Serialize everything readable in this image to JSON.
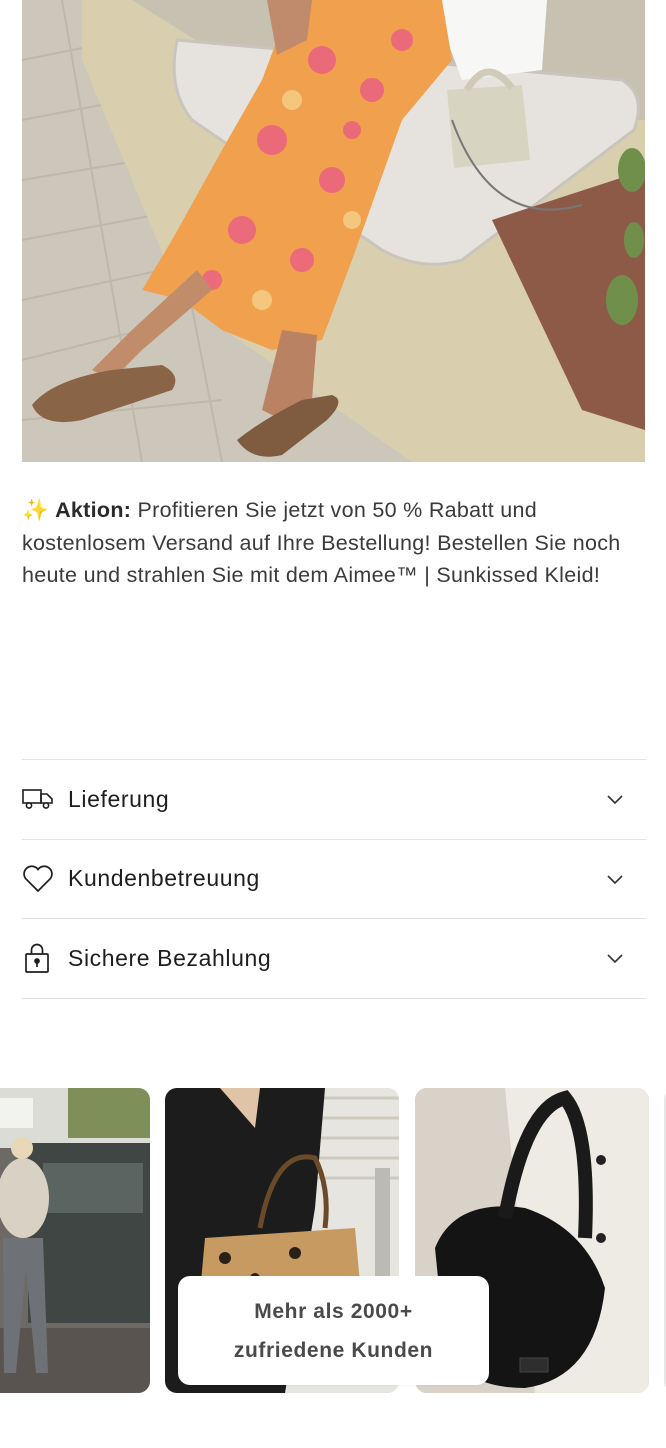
{
  "hero": {
    "image_alt": "Model in orange floral maxi dress with handbag and sandals"
  },
  "promo": {
    "icon": "sparkles-icon",
    "heading": "Aktion:",
    "text": "Profitieren Sie jetzt von 50 % Rabatt und kostenlosem Versand auf Ihre Bestellung! Bestellen Sie noch heute und strahlen Sie mit dem Aimee™ | Sunkissed Kleid!"
  },
  "accordion": {
    "items": [
      {
        "label": "Lieferung",
        "icon": "truck-icon"
      },
      {
        "label": "Kundenbetreuung",
        "icon": "heart-icon"
      },
      {
        "label": "Sichere Bezahlung",
        "icon": "lock-icon"
      }
    ]
  },
  "gallery": {
    "badge_line1": "Mehr als 2000+",
    "badge_line2": "zufriedene Kunden"
  },
  "colors": {
    "text": "#222222",
    "divider": "#e3e3e3",
    "sparkle": "#f2c230"
  }
}
